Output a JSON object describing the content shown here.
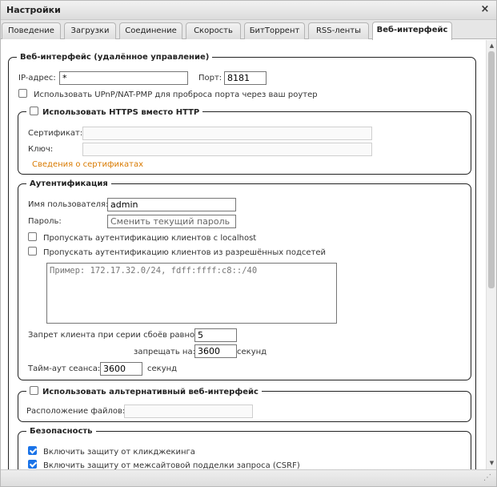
{
  "window": {
    "title": "Настройки",
    "close_glyph": "×"
  },
  "tabs": [
    {
      "label": "Поведение"
    },
    {
      "label": "Загрузки"
    },
    {
      "label": "Соединение"
    },
    {
      "label": "Скорость"
    },
    {
      "label": "БитТоррент"
    },
    {
      "label": "RSS-ленты"
    },
    {
      "label": "Веб-интерфейс",
      "active": true
    }
  ],
  "webui": {
    "legend": "Веб-интерфейс (удалённое управление)",
    "ip_label": "IP-адрес:",
    "ip_value": "*",
    "port_label": "Порт:",
    "port_value": "8181",
    "upnp_label": "Использовать UPnP/NAT-PMP для проброса порта через ваш роутер",
    "upnp_checked": false
  },
  "https": {
    "legend": "Использовать HTTPS вместо HTTP",
    "checked": false,
    "cert_label": "Сертификат:",
    "key_label": "Ключ:",
    "cert_link": "Сведения о сертификатах"
  },
  "auth": {
    "legend": "Аутентификация",
    "username_label": "Имя пользователя:",
    "username_value": "admin",
    "password_label": "Пароль:",
    "password_placeholder": "Сменить текущий пароль",
    "bypass_localhost_label": "Пропускать аутентификацию клиентов с localhost",
    "bypass_subnets_label": "Пропускать аутентификацию клиентов из разрешённых подсетей",
    "subnets_placeholder": "Пример: 172.17.32.0/24, fdff:ffff:c8::/40",
    "ban_label": "Запрет клиента при серии сбоёв равной:",
    "ban_value": "5",
    "ban_for_label": "запрещать на:",
    "ban_for_value": "3600",
    "seconds_label": "секунд",
    "session_label": "Тайм-аут сеанса:",
    "session_value": "3600"
  },
  "alt_ui": {
    "legend": "Использовать альтернативный веб-интерфейс",
    "checked": false,
    "files_label": "Расположение файлов:"
  },
  "security": {
    "legend": "Безопасность",
    "clickjacking_label": "Включить защиту от кликджекинга",
    "csrf_label": "Включить защиту от межсайтовой подделки запроса (CSRF)"
  }
}
